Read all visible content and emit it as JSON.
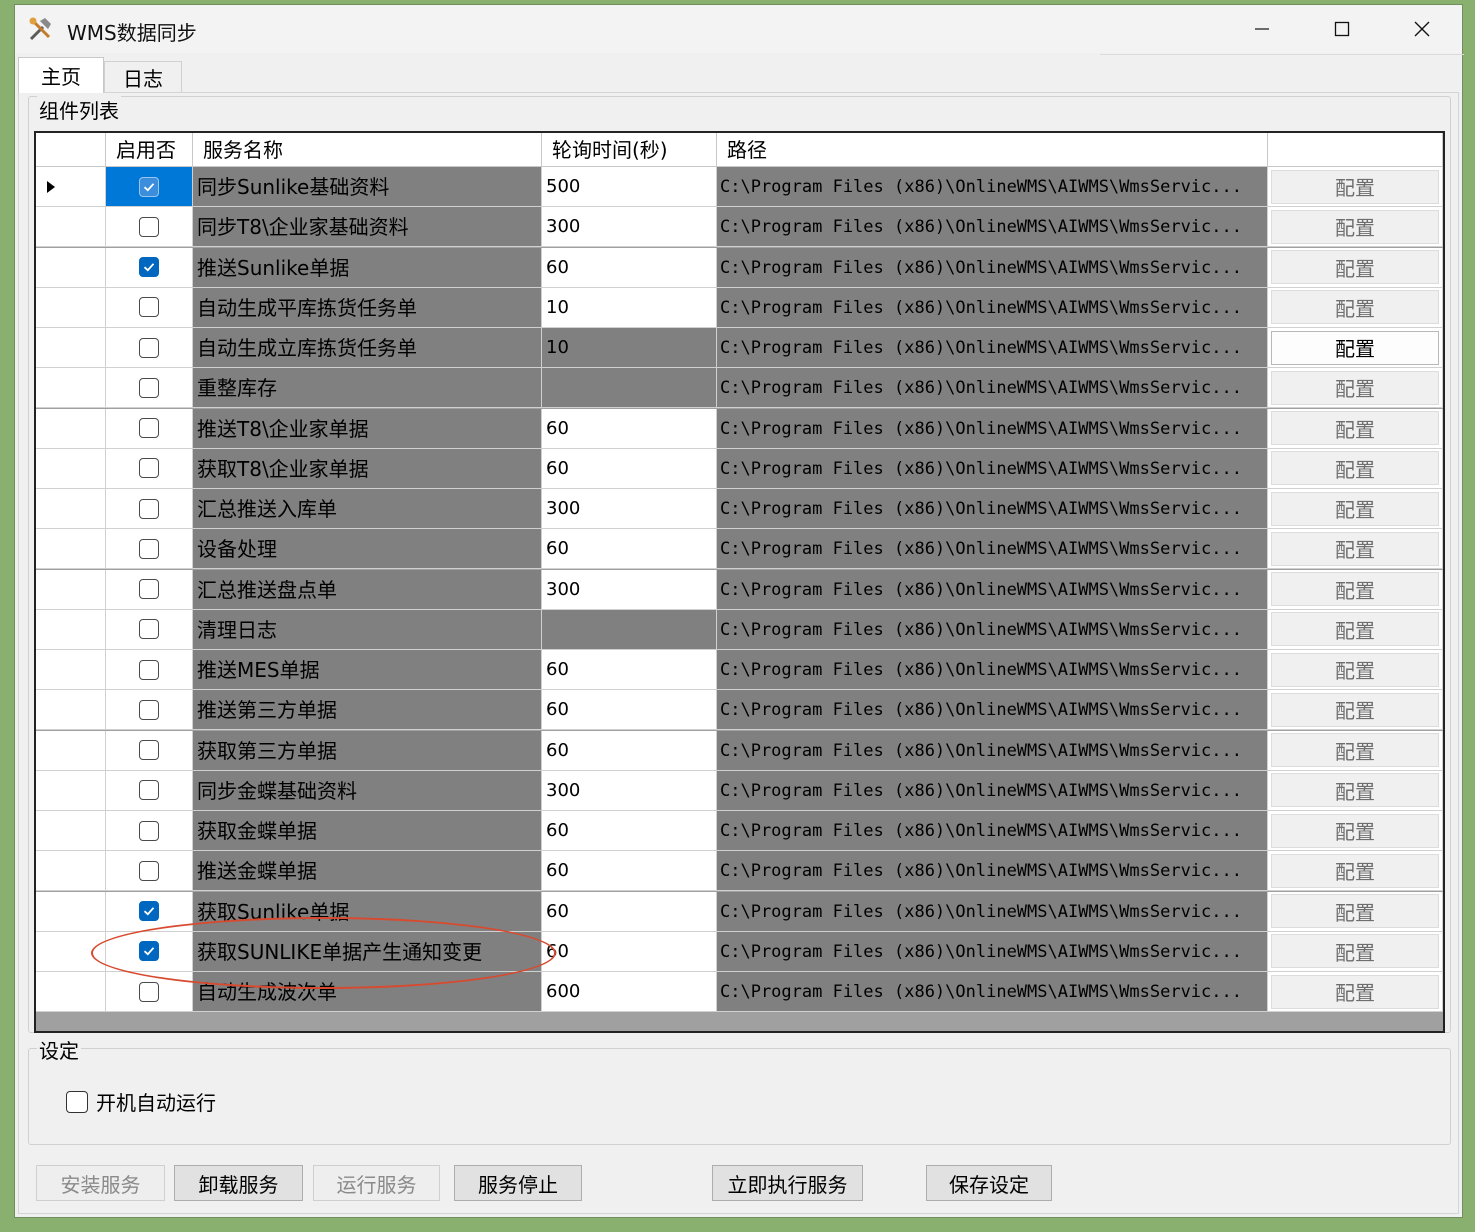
{
  "window": {
    "title": "WMS数据同步"
  },
  "tabs": [
    {
      "label": "主页",
      "active": true
    },
    {
      "label": "日志",
      "active": false
    }
  ],
  "component_group": {
    "label": "组件列表",
    "columns": [
      "启用否",
      "服务名称",
      "轮询时间(秒)",
      "路径",
      ""
    ],
    "rows": [
      {
        "enabled": true,
        "name": "同步Sunlike基础资料",
        "interval": "500",
        "path": "C:\\Program Files (x86)\\OnlineWMS\\AIWMS\\WmsServic...",
        "button": "配置",
        "selected": true
      },
      {
        "enabled": false,
        "name": "同步T8\\企业家基础资料",
        "interval": "300",
        "path": "C:\\Program Files (x86)\\OnlineWMS\\AIWMS\\WmsServic...",
        "button": "配置"
      },
      {
        "enabled": true,
        "name": "推送Sunlike单据",
        "interval": "60",
        "path": "C:\\Program Files (x86)\\OnlineWMS\\AIWMS\\WmsServic...",
        "button": "配置"
      },
      {
        "enabled": false,
        "name": "自动生成平库拣货任务单",
        "interval": "10",
        "path": "C:\\Program Files (x86)\\OnlineWMS\\AIWMS\\WmsServic...",
        "button": "配置"
      },
      {
        "enabled": false,
        "name": "自动生成立库拣货任务单",
        "interval": "10",
        "path": "C:\\Program Files (x86)\\OnlineWMS\\AIWMS\\WmsServic...",
        "button": "配置",
        "interval_dark": true,
        "focused": true
      },
      {
        "enabled": false,
        "name": "重整库存",
        "interval": "",
        "path": "C:\\Program Files (x86)\\OnlineWMS\\AIWMS\\WmsServic...",
        "button": "配置",
        "interval_dark": true
      },
      {
        "enabled": false,
        "name": "推送T8\\企业家单据",
        "interval": "60",
        "path": "C:\\Program Files (x86)\\OnlineWMS\\AIWMS\\WmsServic...",
        "button": "配置"
      },
      {
        "enabled": false,
        "name": "获取T8\\企业家单据",
        "interval": "60",
        "path": "C:\\Program Files (x86)\\OnlineWMS\\AIWMS\\WmsServic...",
        "button": "配置"
      },
      {
        "enabled": false,
        "name": "汇总推送入库单",
        "interval": "300",
        "path": "C:\\Program Files (x86)\\OnlineWMS\\AIWMS\\WmsServic...",
        "button": "配置"
      },
      {
        "enabled": false,
        "name": "设备处理",
        "interval": "60",
        "path": "C:\\Program Files (x86)\\OnlineWMS\\AIWMS\\WmsServic...",
        "button": "配置"
      },
      {
        "enabled": false,
        "name": "汇总推送盘点单",
        "interval": "300",
        "path": "C:\\Program Files (x86)\\OnlineWMS\\AIWMS\\WmsServic...",
        "button": "配置"
      },
      {
        "enabled": false,
        "name": "清理日志",
        "interval": "",
        "path": "C:\\Program Files (x86)\\OnlineWMS\\AIWMS\\WmsServic...",
        "button": "配置",
        "interval_dark": true
      },
      {
        "enabled": false,
        "name": "推送MES单据",
        "interval": "60",
        "path": "C:\\Program Files (x86)\\OnlineWMS\\AIWMS\\WmsServic...",
        "button": "配置"
      },
      {
        "enabled": false,
        "name": "推送第三方单据",
        "interval": "60",
        "path": "C:\\Program Files (x86)\\OnlineWMS\\AIWMS\\WmsServic...",
        "button": "配置"
      },
      {
        "enabled": false,
        "name": "获取第三方单据",
        "interval": "60",
        "path": "C:\\Program Files (x86)\\OnlineWMS\\AIWMS\\WmsServic...",
        "button": "配置"
      },
      {
        "enabled": false,
        "name": "同步金蝶基础资料",
        "interval": "300",
        "path": "C:\\Program Files (x86)\\OnlineWMS\\AIWMS\\WmsServic...",
        "button": "配置"
      },
      {
        "enabled": false,
        "name": "获取金蝶单据",
        "interval": "60",
        "path": "C:\\Program Files (x86)\\OnlineWMS\\AIWMS\\WmsServic...",
        "button": "配置"
      },
      {
        "enabled": false,
        "name": "推送金蝶单据",
        "interval": "60",
        "path": "C:\\Program Files (x86)\\OnlineWMS\\AIWMS\\WmsServic...",
        "button": "配置"
      },
      {
        "enabled": true,
        "name": "获取Sunlike单据",
        "interval": "60",
        "path": "C:\\Program Files (x86)\\OnlineWMS\\AIWMS\\WmsServic...",
        "button": "配置"
      },
      {
        "enabled": true,
        "name": "获取SUNLIKE单据产生通知变更",
        "interval": "60",
        "path": "C:\\Program Files (x86)\\OnlineWMS\\AIWMS\\WmsServic...",
        "button": "配置"
      },
      {
        "enabled": false,
        "name": "自动生成波次单",
        "interval": "600",
        "path": "C:\\Program Files (x86)\\OnlineWMS\\AIWMS\\WmsServic...",
        "button": "配置"
      }
    ]
  },
  "settings_group": {
    "label": "设定",
    "autorun_label": "开机自动运行",
    "autorun_checked": false
  },
  "buttons": {
    "install": "安装服务",
    "uninstall": "卸载服务",
    "run": "运行服务",
    "stop": "服务停止",
    "execute_now": "立即执行服务",
    "save": "保存设定"
  },
  "colors": {
    "accent": "#0067c0",
    "annotation": "#d84a2f",
    "cell_dark": "#808080"
  }
}
